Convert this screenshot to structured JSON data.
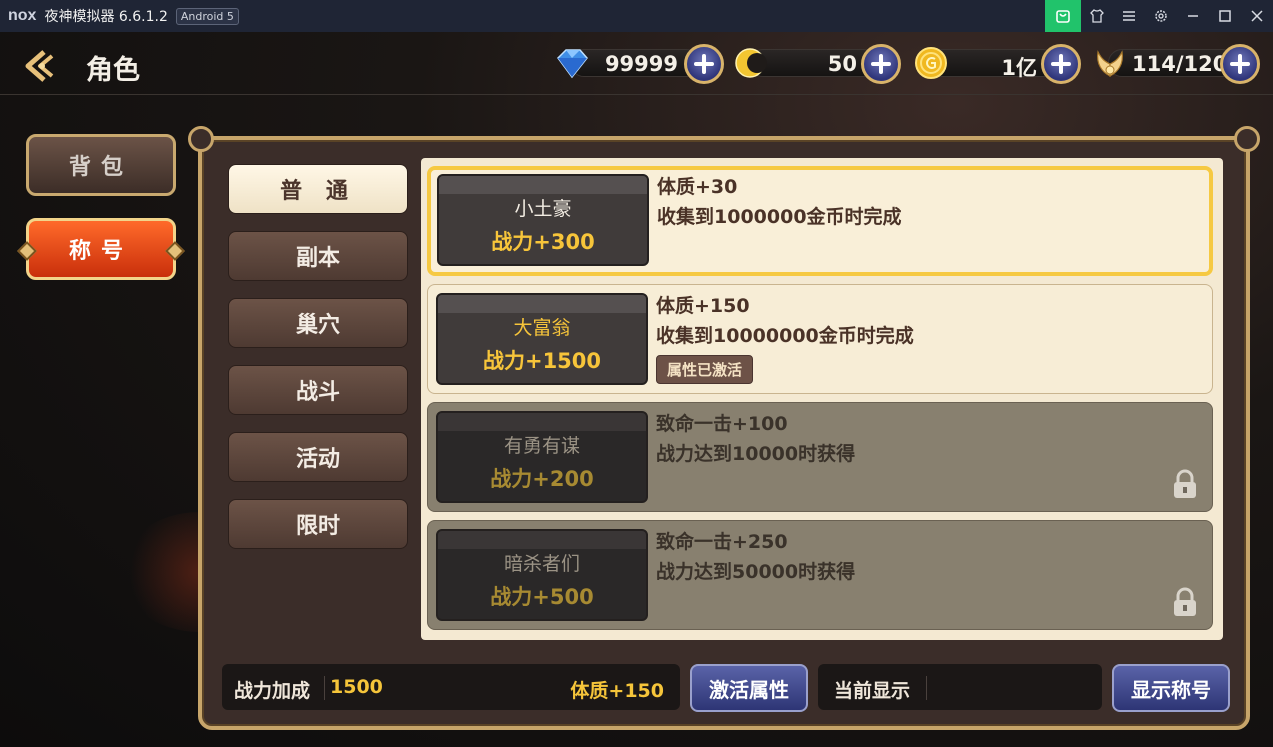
{
  "emulator": {
    "logo": "nox",
    "title": "夜神模拟器 6.6.1.2",
    "badge": "Android 5"
  },
  "header": {
    "title": "角色",
    "resources": [
      {
        "icon": "diamond-gem-icon",
        "value": "99999"
      },
      {
        "icon": "crescent-moon-icon",
        "value": "50"
      },
      {
        "icon": "gold-coin-icon",
        "value": "1亿"
      },
      {
        "icon": "wing-stamina-icon",
        "value": "114/120"
      }
    ]
  },
  "side": {
    "bag": "背包",
    "title": "称号"
  },
  "tabs": [
    "普 通",
    "副本",
    "巢穴",
    "战斗",
    "活动",
    "限时"
  ],
  "titles": [
    {
      "name": "小土豪",
      "power": "战力+300",
      "effect": "体质+30",
      "condition": "收集到1000000金币时完成",
      "state": "selected"
    },
    {
      "name": "大富翁",
      "power": "战力+1500",
      "effect": "体质+150",
      "condition": "收集到10000000金币时完成",
      "state": "activated",
      "tag": "属性已激活"
    },
    {
      "name": "有勇有谋",
      "power": "战力+200",
      "effect": "致命一击+100",
      "condition": "战力达到10000时获得",
      "state": "locked"
    },
    {
      "name": "暗杀者们",
      "power": "战力+500",
      "effect": "致命一击+250",
      "condition": "战力达到50000时获得",
      "state": "locked"
    }
  ],
  "footer": {
    "bonus_label": "战力加成",
    "bonus_value": "1500",
    "bonus_attr": "体质+150",
    "activate_button": "激活属性",
    "current_label": "当前显示",
    "current_value": "",
    "show_button": "显示称号"
  },
  "colors": {
    "accent_gold": "#f6c53a",
    "panel_border": "#c7a56a",
    "active_orange": "#e8461a",
    "button_blue": "#3a4290"
  }
}
